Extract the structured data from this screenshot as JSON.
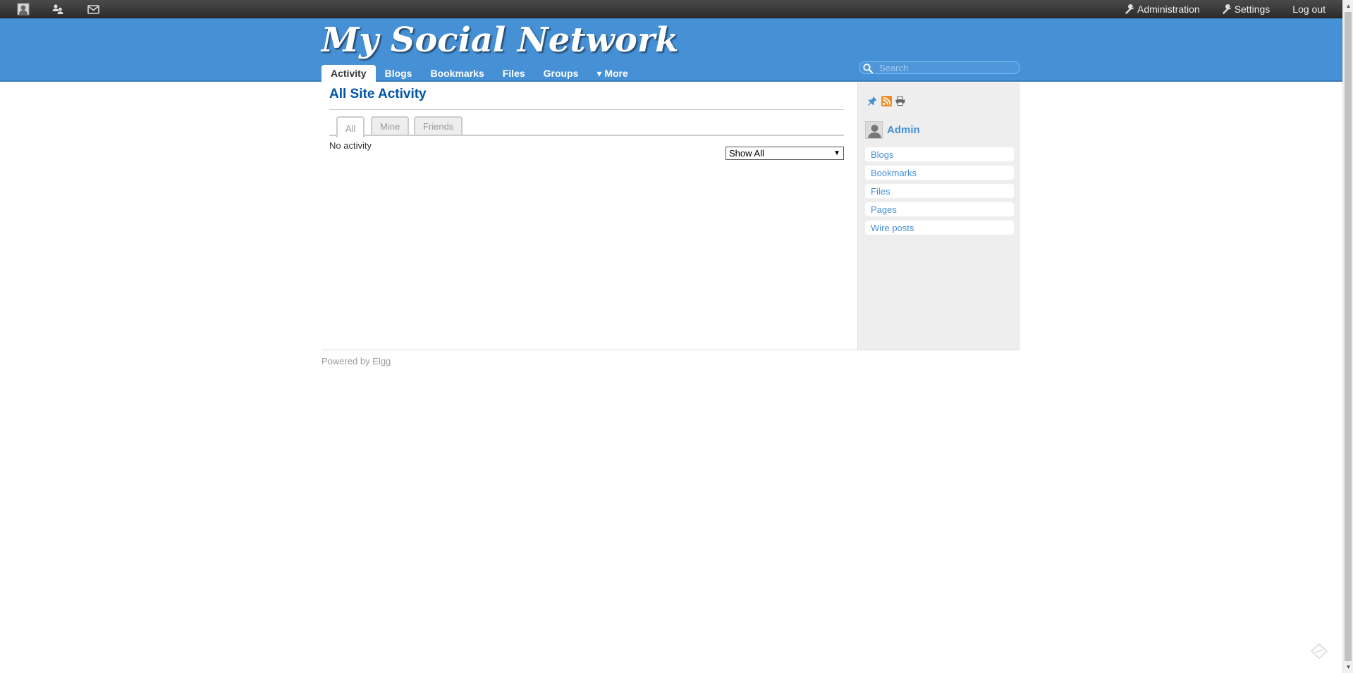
{
  "topbar": {
    "icons": [
      {
        "name": "profile-icon"
      },
      {
        "name": "friends-icon"
      },
      {
        "name": "messages-icon"
      }
    ],
    "links": [
      {
        "label": "Administration",
        "icon": "wrench-icon"
      },
      {
        "label": "Settings",
        "icon": "wrench-icon"
      },
      {
        "label": "Log out",
        "icon": ""
      }
    ]
  },
  "header": {
    "site_title": "My Social Network",
    "search_placeholder": "Search",
    "nav": [
      {
        "label": "Activity",
        "active": true
      },
      {
        "label": "Blogs",
        "active": false
      },
      {
        "label": "Bookmarks",
        "active": false
      },
      {
        "label": "Files",
        "active": false
      },
      {
        "label": "Groups",
        "active": false
      },
      {
        "label": "▾ More",
        "active": false
      }
    ]
  },
  "main": {
    "title": "All Site Activity",
    "tabs": [
      {
        "label": "All",
        "active": true
      },
      {
        "label": "Mine",
        "active": false
      },
      {
        "label": "Friends",
        "active": false
      }
    ],
    "empty_text": "No activity",
    "filter": {
      "selected": "Show All",
      "arrow": "▼"
    }
  },
  "sidebar": {
    "icons": [
      "pushpin-icon",
      "rss-icon",
      "print-icon"
    ],
    "owner_name": "Admin",
    "menu": [
      "Blogs",
      "Bookmarks",
      "Files",
      "Pages",
      "Wire posts"
    ]
  },
  "footer": {
    "prefix": "Powered by ",
    "link": "Elgg"
  },
  "colors": {
    "header_blue": "#4690d6",
    "link_blue": "#4690d6",
    "title_blue": "#0054a7",
    "sidebar_bg": "#eeeeee"
  }
}
